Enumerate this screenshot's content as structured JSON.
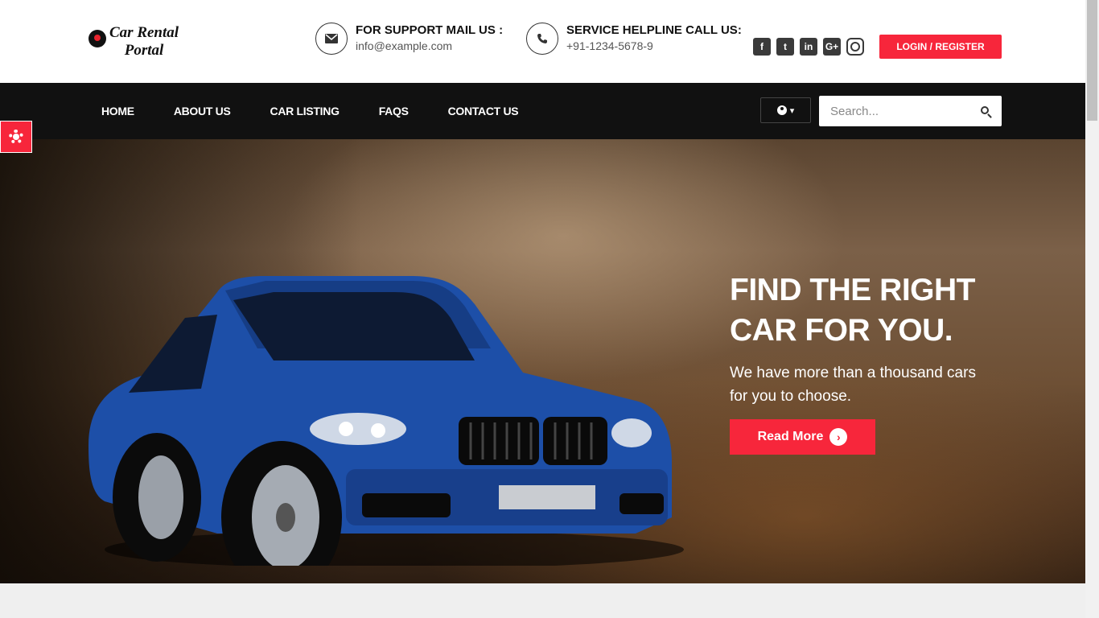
{
  "brand": {
    "line1": "Car Rental",
    "line2": "Portal"
  },
  "contact": {
    "mail_title": "FOR SUPPORT MAIL US :",
    "mail_value": "info@example.com",
    "phone_title": "SERVICE HELPLINE CALL US:",
    "phone_value": "+91-1234-5678-9"
  },
  "socials": [
    {
      "icon": "facebook-icon",
      "glyph": "f"
    },
    {
      "icon": "twitter-icon",
      "glyph": "t"
    },
    {
      "icon": "linkedin-icon",
      "glyph": "in"
    },
    {
      "icon": "google-plus-icon",
      "glyph": "G+"
    },
    {
      "icon": "instagram-icon",
      "glyph": ""
    }
  ],
  "header": {
    "login_label": "LOGIN / REGISTER"
  },
  "nav": {
    "items": [
      "HOME",
      "ABOUT US",
      "CAR LISTING",
      "FAQS",
      "CONTACT US"
    ],
    "user_caret": "▾",
    "search_placeholder": "Search..."
  },
  "hero": {
    "title": "FIND THE RIGHT CAR FOR YOU.",
    "subtitle": "We have more than a thousand cars for you to choose.",
    "button_label": "Read More",
    "button_arrow": "›"
  },
  "colors": {
    "accent": "#f7263b",
    "nav_bg": "#111111"
  }
}
